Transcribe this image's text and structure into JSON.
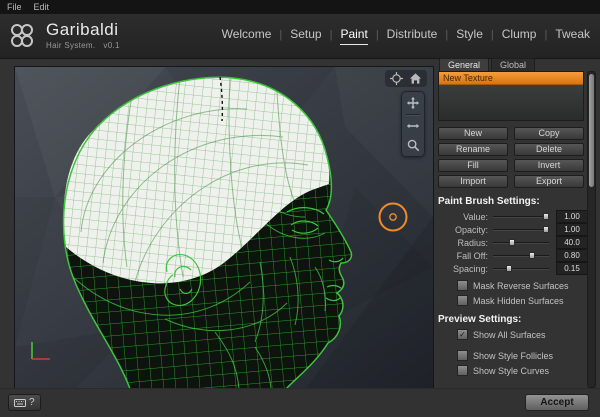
{
  "accent_color": "#e8871f",
  "wireframe_color": "#3cc43c",
  "menubar": {
    "items": [
      "File",
      "Edit"
    ]
  },
  "header": {
    "title": "Garibaldi",
    "subtitle": "Hair System.",
    "version": "v0.1",
    "nav_items": [
      "Welcome",
      "Setup",
      "Paint",
      "Distribute",
      "Style",
      "Clump",
      "Tweak"
    ],
    "active_nav": "Paint"
  },
  "viewport": {
    "corner_icons": [
      "crosshair-icon",
      "home-icon"
    ],
    "toolbar_icons": [
      "pan-icon",
      "track-icon",
      "zoom-icon"
    ],
    "brush_cursor": {
      "color": "#ef8c26"
    }
  },
  "panel": {
    "tabs": [
      {
        "label": "General",
        "active": true
      },
      {
        "label": "Global",
        "active": false
      }
    ],
    "texture_list": [
      {
        "label": "New Texture",
        "selected": true
      }
    ],
    "action_buttons": [
      "New",
      "Copy",
      "Rename",
      "Delete",
      "Fill",
      "Invert",
      "Import",
      "Export"
    ],
    "brush": {
      "title": "Paint Brush Settings:",
      "sliders": [
        {
          "label": "Value:",
          "value": "1.00",
          "pct": 95
        },
        {
          "label": "Opacity:",
          "value": "1.00",
          "pct": 95
        },
        {
          "label": "Radius:",
          "value": "40.0",
          "pct": 34
        },
        {
          "label": "Fall Off:",
          "value": "0.80",
          "pct": 70
        },
        {
          "label": "Spacing:",
          "value": "0.15",
          "pct": 28
        }
      ],
      "checkboxes": [
        {
          "label": "Mask Reverse Surfaces",
          "checked": false
        },
        {
          "label": "Mask Hidden Surfaces",
          "checked": false
        }
      ]
    },
    "preview": {
      "title": "Preview Settings:",
      "checkboxes": [
        {
          "label": "Show All Surfaces",
          "checked": true
        },
        {
          "label": "Show Style Follicles",
          "checked": false
        },
        {
          "label": "Show Style Curves",
          "checked": false
        }
      ]
    }
  },
  "footer": {
    "help_label": "?",
    "accept_label": "Accept"
  }
}
